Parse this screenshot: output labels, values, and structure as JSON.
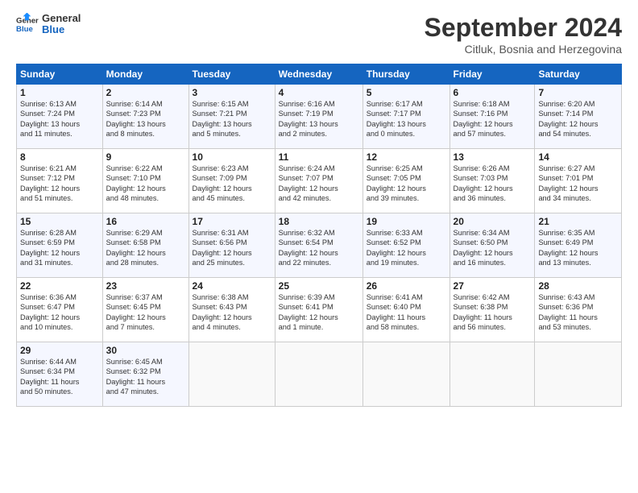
{
  "header": {
    "title": "September 2024",
    "subtitle": "Citluk, Bosnia and Herzegovina"
  },
  "calendar": {
    "headers": [
      "Sunday",
      "Monday",
      "Tuesday",
      "Wednesday",
      "Thursday",
      "Friday",
      "Saturday"
    ],
    "weeks": [
      [
        {
          "day": "1",
          "lines": [
            "Sunrise: 6:13 AM",
            "Sunset: 7:24 PM",
            "Daylight: 13 hours",
            "and 11 minutes."
          ]
        },
        {
          "day": "2",
          "lines": [
            "Sunrise: 6:14 AM",
            "Sunset: 7:23 PM",
            "Daylight: 13 hours",
            "and 8 minutes."
          ]
        },
        {
          "day": "3",
          "lines": [
            "Sunrise: 6:15 AM",
            "Sunset: 7:21 PM",
            "Daylight: 13 hours",
            "and 5 minutes."
          ]
        },
        {
          "day": "4",
          "lines": [
            "Sunrise: 6:16 AM",
            "Sunset: 7:19 PM",
            "Daylight: 13 hours",
            "and 2 minutes."
          ]
        },
        {
          "day": "5",
          "lines": [
            "Sunrise: 6:17 AM",
            "Sunset: 7:17 PM",
            "Daylight: 13 hours",
            "and 0 minutes."
          ]
        },
        {
          "day": "6",
          "lines": [
            "Sunrise: 6:18 AM",
            "Sunset: 7:16 PM",
            "Daylight: 12 hours",
            "and 57 minutes."
          ]
        },
        {
          "day": "7",
          "lines": [
            "Sunrise: 6:20 AM",
            "Sunset: 7:14 PM",
            "Daylight: 12 hours",
            "and 54 minutes."
          ]
        }
      ],
      [
        {
          "day": "8",
          "lines": [
            "Sunrise: 6:21 AM",
            "Sunset: 7:12 PM",
            "Daylight: 12 hours",
            "and 51 minutes."
          ]
        },
        {
          "day": "9",
          "lines": [
            "Sunrise: 6:22 AM",
            "Sunset: 7:10 PM",
            "Daylight: 12 hours",
            "and 48 minutes."
          ]
        },
        {
          "day": "10",
          "lines": [
            "Sunrise: 6:23 AM",
            "Sunset: 7:09 PM",
            "Daylight: 12 hours",
            "and 45 minutes."
          ]
        },
        {
          "day": "11",
          "lines": [
            "Sunrise: 6:24 AM",
            "Sunset: 7:07 PM",
            "Daylight: 12 hours",
            "and 42 minutes."
          ]
        },
        {
          "day": "12",
          "lines": [
            "Sunrise: 6:25 AM",
            "Sunset: 7:05 PM",
            "Daylight: 12 hours",
            "and 39 minutes."
          ]
        },
        {
          "day": "13",
          "lines": [
            "Sunrise: 6:26 AM",
            "Sunset: 7:03 PM",
            "Daylight: 12 hours",
            "and 36 minutes."
          ]
        },
        {
          "day": "14",
          "lines": [
            "Sunrise: 6:27 AM",
            "Sunset: 7:01 PM",
            "Daylight: 12 hours",
            "and 34 minutes."
          ]
        }
      ],
      [
        {
          "day": "15",
          "lines": [
            "Sunrise: 6:28 AM",
            "Sunset: 6:59 PM",
            "Daylight: 12 hours",
            "and 31 minutes."
          ]
        },
        {
          "day": "16",
          "lines": [
            "Sunrise: 6:29 AM",
            "Sunset: 6:58 PM",
            "Daylight: 12 hours",
            "and 28 minutes."
          ]
        },
        {
          "day": "17",
          "lines": [
            "Sunrise: 6:31 AM",
            "Sunset: 6:56 PM",
            "Daylight: 12 hours",
            "and 25 minutes."
          ]
        },
        {
          "day": "18",
          "lines": [
            "Sunrise: 6:32 AM",
            "Sunset: 6:54 PM",
            "Daylight: 12 hours",
            "and 22 minutes."
          ]
        },
        {
          "day": "19",
          "lines": [
            "Sunrise: 6:33 AM",
            "Sunset: 6:52 PM",
            "Daylight: 12 hours",
            "and 19 minutes."
          ]
        },
        {
          "day": "20",
          "lines": [
            "Sunrise: 6:34 AM",
            "Sunset: 6:50 PM",
            "Daylight: 12 hours",
            "and 16 minutes."
          ]
        },
        {
          "day": "21",
          "lines": [
            "Sunrise: 6:35 AM",
            "Sunset: 6:49 PM",
            "Daylight: 12 hours",
            "and 13 minutes."
          ]
        }
      ],
      [
        {
          "day": "22",
          "lines": [
            "Sunrise: 6:36 AM",
            "Sunset: 6:47 PM",
            "Daylight: 12 hours",
            "and 10 minutes."
          ]
        },
        {
          "day": "23",
          "lines": [
            "Sunrise: 6:37 AM",
            "Sunset: 6:45 PM",
            "Daylight: 12 hours",
            "and 7 minutes."
          ]
        },
        {
          "day": "24",
          "lines": [
            "Sunrise: 6:38 AM",
            "Sunset: 6:43 PM",
            "Daylight: 12 hours",
            "and 4 minutes."
          ]
        },
        {
          "day": "25",
          "lines": [
            "Sunrise: 6:39 AM",
            "Sunset: 6:41 PM",
            "Daylight: 12 hours",
            "and 1 minute."
          ]
        },
        {
          "day": "26",
          "lines": [
            "Sunrise: 6:41 AM",
            "Sunset: 6:40 PM",
            "Daylight: 11 hours",
            "and 58 minutes."
          ]
        },
        {
          "day": "27",
          "lines": [
            "Sunrise: 6:42 AM",
            "Sunset: 6:38 PM",
            "Daylight: 11 hours",
            "and 56 minutes."
          ]
        },
        {
          "day": "28",
          "lines": [
            "Sunrise: 6:43 AM",
            "Sunset: 6:36 PM",
            "Daylight: 11 hours",
            "and 53 minutes."
          ]
        }
      ],
      [
        {
          "day": "29",
          "lines": [
            "Sunrise: 6:44 AM",
            "Sunset: 6:34 PM",
            "Daylight: 11 hours",
            "and 50 minutes."
          ]
        },
        {
          "day": "30",
          "lines": [
            "Sunrise: 6:45 AM",
            "Sunset: 6:32 PM",
            "Daylight: 11 hours",
            "and 47 minutes."
          ]
        },
        {
          "day": "",
          "lines": []
        },
        {
          "day": "",
          "lines": []
        },
        {
          "day": "",
          "lines": []
        },
        {
          "day": "",
          "lines": []
        },
        {
          "day": "",
          "lines": []
        }
      ]
    ]
  }
}
